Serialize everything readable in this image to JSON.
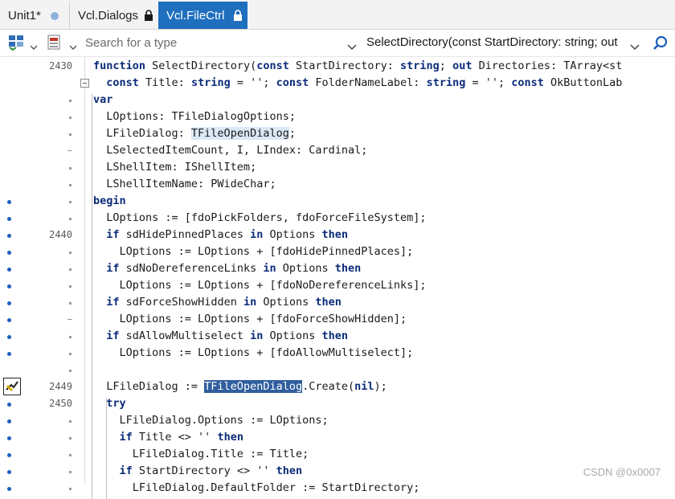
{
  "tabs": [
    {
      "label": "Unit1*"
    },
    {
      "label": "Vcl.Dialogs"
    },
    {
      "label": "Vcl.FileCtrl"
    }
  ],
  "toolbar": {
    "search_placeholder": "Search for a type",
    "method_selected": "SelectDirectory(const StartDirectory: string; out"
  },
  "watermark": "CSDN @0x0007",
  "lines": [
    {
      "num": "2430",
      "bp": false,
      "mark": "none"
    },
    {
      "num": "",
      "bp": false,
      "mark": "fold"
    },
    {
      "num": "",
      "bp": false,
      "mark": "dot"
    },
    {
      "num": "",
      "bp": false,
      "mark": "dot"
    },
    {
      "num": "",
      "bp": false,
      "mark": "dot"
    },
    {
      "num": "",
      "bp": false,
      "mark": "dash"
    },
    {
      "num": "",
      "bp": false,
      "mark": "dot"
    },
    {
      "num": "",
      "bp": false,
      "mark": "dot"
    },
    {
      "num": "",
      "bp": true,
      "mark": "dot"
    },
    {
      "num": "",
      "bp": true,
      "mark": "dot"
    },
    {
      "num": "2440",
      "bp": true,
      "mark": "none"
    },
    {
      "num": "",
      "bp": true,
      "mark": "dot"
    },
    {
      "num": "",
      "bp": true,
      "mark": "dot"
    },
    {
      "num": "",
      "bp": true,
      "mark": "dot"
    },
    {
      "num": "",
      "bp": true,
      "mark": "dot"
    },
    {
      "num": "",
      "bp": true,
      "mark": "dash"
    },
    {
      "num": "",
      "bp": true,
      "mark": "dot"
    },
    {
      "num": "",
      "bp": true,
      "mark": "dot"
    },
    {
      "num": "",
      "bp": false,
      "mark": "dot"
    },
    {
      "num": "2449",
      "bp": false,
      "mark": "exec"
    },
    {
      "num": "2450",
      "bp": true,
      "mark": "none"
    },
    {
      "num": "",
      "bp": true,
      "mark": "dot"
    },
    {
      "num": "",
      "bp": true,
      "mark": "dot"
    },
    {
      "num": "",
      "bp": true,
      "mark": "dot"
    },
    {
      "num": "",
      "bp": true,
      "mark": "dot"
    },
    {
      "num": "",
      "bp": true,
      "mark": "dot"
    }
  ],
  "code": [
    "function SelectDirectory(const StartDirectory: string; out Directories: TArray<st",
    "  const Title: string = ''; const FolderNameLabel: string = ''; const OkButtonLab",
    "var",
    "  LOptions: TFileDialogOptions;",
    "  LFileDialog: TFileOpenDialog;",
    "  LSelectedItemCount, I, LIndex: Cardinal;",
    "  LShellItem: IShellItem;",
    "  LShellItemName: PWideChar;",
    "begin",
    "  LOptions := [fdoPickFolders, fdoForceFileSystem];",
    "  if sdHidePinnedPlaces in Options then",
    "    LOptions := LOptions + [fdoHidePinnedPlaces];",
    "  if sdNoDereferenceLinks in Options then",
    "    LOptions := LOptions + [fdoNoDereferenceLinks];",
    "  if sdForceShowHidden in Options then",
    "    LOptions := LOptions + [fdoForceShowHidden];",
    "  if sdAllowMultiselect in Options then",
    "    LOptions := LOptions + [fdoAllowMultiselect];",
    "",
    "  LFileDialog := TFileOpenDialog.Create(nil);",
    "  try",
    "    LFileDialog.Options := LOptions;",
    "    if Title <> '' then",
    "      LFileDialog.Title := Title;",
    "    if StartDirectory <> '' then",
    "      LFileDialog.DefaultFolder := StartDirectory;"
  ],
  "keywords": [
    "function",
    "const",
    "string",
    "out",
    "var",
    "begin",
    "if",
    "in",
    "then",
    "try",
    "nil"
  ],
  "highlights": {
    "soft_word": "TFileOpenDialog",
    "soft_line": 4,
    "sel_word": "TFileOpenDialog",
    "sel_line": 19
  },
  "colors": {
    "active_tab": "#1f6fbf",
    "breakpoint": "#1f5fbf",
    "keyword": "#0c2c7a",
    "selection": "#305e9e"
  }
}
